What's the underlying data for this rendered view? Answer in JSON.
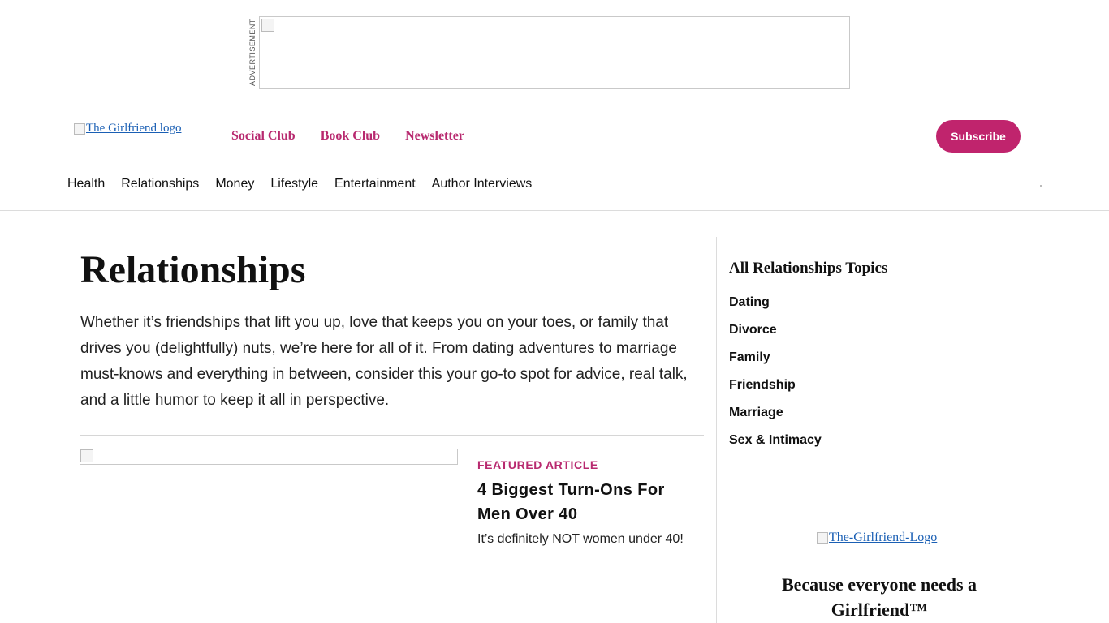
{
  "ad": {
    "label": "ADVERTISEMENT"
  },
  "header": {
    "logo_alt": "The Girlfriend logo",
    "nav": [
      "Social Club",
      "Book Club",
      "Newsletter"
    ],
    "subscribe_label": "Subscribe"
  },
  "category_nav": [
    "Health",
    "Relationships",
    "Money",
    "Lifestyle",
    "Entertainment",
    "Author Interviews"
  ],
  "main": {
    "title": "Relationships",
    "intro": "Whether it’s friendships that lift you up, love that keeps you on your toes, or family that drives you (delightfully) nuts, we’re here for all of it. From dating adventures to marriage must-knows and everything in between, consider this your go-to spot for advice, real talk, and a little humor to keep it all in perspective.",
    "featured": {
      "label": "FEATURED ARTICLE",
      "title": "4 Biggest Turn-Ons For Men Over 40",
      "dek": "It’s definitely NOT women under 40!"
    }
  },
  "sidebar": {
    "heading": "All Relationships Topics",
    "topics": [
      "Dating",
      "Divorce",
      "Family",
      "Friendship",
      "Marriage",
      "Sex & Intimacy"
    ],
    "logo_alt": "The-Girlfriend-Logo",
    "tagline": "Because everyone needs a Girlfriend™"
  },
  "colors": {
    "accent": "#b8296f",
    "button": "#c0246d",
    "link": "#1a5fb4"
  }
}
